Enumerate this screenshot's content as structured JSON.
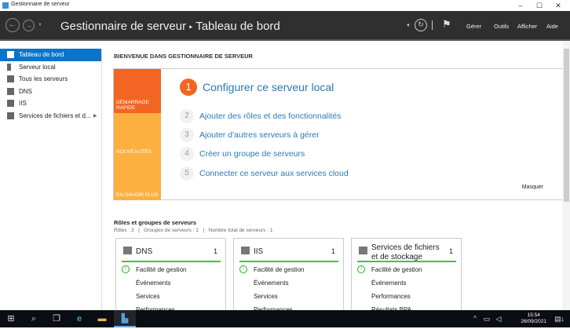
{
  "window": {
    "title": "Gestionnaire de serveur"
  },
  "header": {
    "app": "Gestionnaire de serveur",
    "separator": "▸",
    "page": "Tableau de bord",
    "menus": [
      "Gérer",
      "Outils",
      "Afficher",
      "Aide"
    ]
  },
  "sidebar": {
    "items": [
      {
        "label": "Tableau de bord",
        "selected": true
      },
      {
        "label": "Serveur local"
      },
      {
        "label": "Tous les serveurs"
      },
      {
        "label": "DNS"
      },
      {
        "label": "IIS"
      },
      {
        "label": "Services de fichiers et d..."
      }
    ]
  },
  "welcome": {
    "heading": "BIENVENUE DANS GESTIONNAIRE DE SERVEUR",
    "tiles": [
      "DÉMARRAGE RAPIDE",
      "NOUVEAUTÉS",
      "EN SAVOIR PLUS"
    ],
    "steps": [
      {
        "n": "1",
        "label": "Configurer ce serveur local"
      },
      {
        "n": "2",
        "label": "Ajouter des rôles et des fonctionnalités"
      },
      {
        "n": "3",
        "label": "Ajouter d'autres serveurs à gérer"
      },
      {
        "n": "4",
        "label": "Créer un groupe de serveurs"
      },
      {
        "n": "5",
        "label": "Connecter ce serveur aux services cloud"
      }
    ],
    "hide": "Masquer"
  },
  "roles": {
    "heading": "Rôles et groupes de serveurs",
    "summary": "Rôles : 3   |   Groupes de serveurs : 1   |   Nombre total de serveurs : 1",
    "cards": [
      {
        "title": "DNS",
        "count": "1",
        "rows": [
          "Facilité de gestion",
          "Événements",
          "Services",
          "Performances"
        ]
      },
      {
        "title": "IIS",
        "count": "1",
        "rows": [
          "Facilité de gestion",
          "Événements",
          "Services",
          "Performances"
        ]
      },
      {
        "title": "Services de fichiers et de stockage",
        "count": "1",
        "rows": [
          "Facilité de gestion",
          "Événements",
          "Performances",
          "Résultats BPA"
        ]
      }
    ]
  },
  "taskbar": {
    "time": "15:54",
    "date": "26/09/2021",
    "notifications": "1"
  },
  "colors": {
    "accent": "#0a74c9",
    "orange": "#f26522",
    "yellow": "#fbb040",
    "green": "#3ec53e"
  }
}
